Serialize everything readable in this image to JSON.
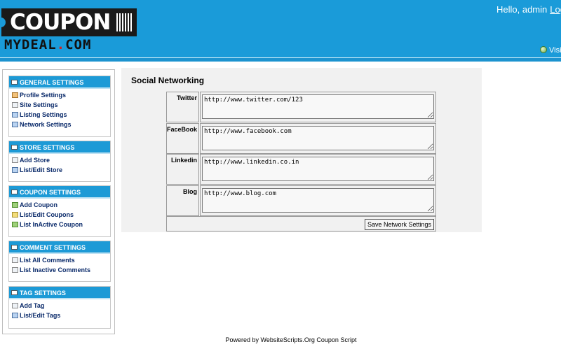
{
  "header": {
    "logo_top": "COUPON",
    "logo_bottom_a": "MYDEAL",
    "logo_bottom_dot": ".",
    "logo_bottom_b": "COM",
    "greeting": "Hello, admin",
    "logout_label": "Log",
    "visit_label": "Visi"
  },
  "sidebar": {
    "general": {
      "title": "GENERAL SETTINGS",
      "items": [
        "Profile Settings",
        "Site Settings",
        "Listing Settings",
        "Network Settings"
      ]
    },
    "store": {
      "title": "STORE SETTINGS",
      "items": [
        "Add Store",
        "List/Edit Store"
      ]
    },
    "coupon": {
      "title": "COUPON SETTINGS",
      "items": [
        "Add Coupon",
        "List/Edit Coupons",
        "List InActive Coupon"
      ]
    },
    "comment": {
      "title": "COMMENT SETTINGS",
      "items": [
        "List All Comments",
        "List Inactive Comments"
      ]
    },
    "tag": {
      "title": "TAG SETTINGS",
      "items": [
        "Add Tag",
        "List/Edit Tags"
      ]
    }
  },
  "main": {
    "title": "Social Networking",
    "fields": [
      {
        "label": "Twitter",
        "value": "http://www.twitter.com/123"
      },
      {
        "label": "FaceBook",
        "value": "http://www.facebook.com"
      },
      {
        "label": "Linkedin",
        "value": "http://www.linkedin.co.in"
      },
      {
        "label": "Blog",
        "value": "http://www.blog.com"
      }
    ],
    "save_label": "Save Network Settings"
  },
  "footer": {
    "text": "Powered by WebsiteScripts.Org Coupon Script"
  },
  "colors": {
    "header_bg": "#1a9bd9",
    "panel_head": "#1d9ad6",
    "content_bg": "#f1f1f1"
  }
}
